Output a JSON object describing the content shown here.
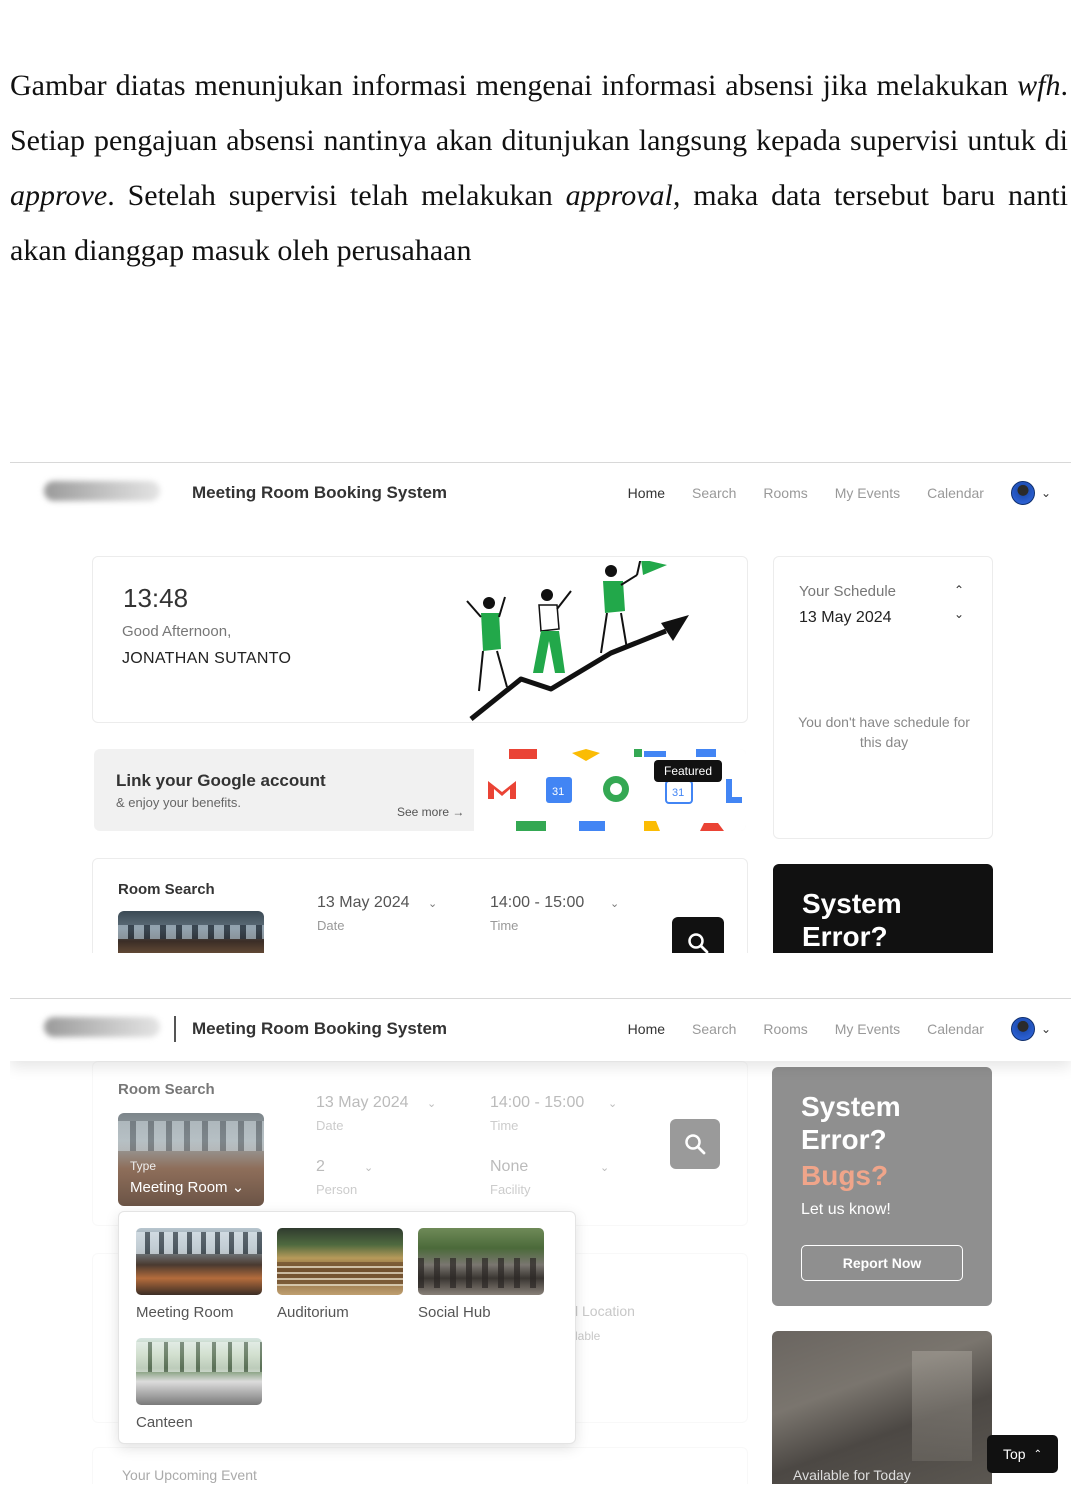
{
  "document": {
    "paragraph_parts": [
      "Gambar diatas menunjukan informasi mengenai informasi absensi jika melakukan ",
      "wfh",
      ". Setiap pengajuan absensi nantinya akan ditunjukan langsung kepada supervisi untuk di ",
      "approve",
      ". Setelah supervisi telah melakukan ",
      "approval,",
      " maka data tersebut baru nanti akan dianggap masuk oleh perusahaan"
    ]
  },
  "app": {
    "title": "Meeting Room Booking System",
    "nav": [
      "Home",
      "Search",
      "Rooms",
      "My Events",
      "Calendar"
    ],
    "active_nav": "Home",
    "caret": "⌄"
  },
  "dashboard": {
    "clock": "13:48",
    "greeting": "Good Afternoon,",
    "username": "JONATHAN SUTANTO",
    "schedule": {
      "title": "Your Schedule",
      "date": "13 May 2024",
      "up_icon": "⌃",
      "down_icon": "⌄",
      "empty": "You don't have schedule for this day"
    },
    "google": {
      "title": "Link your Google account",
      "subtitle": "& enjoy your benefits.",
      "see_more": "See more →",
      "featured": "Featured"
    },
    "room_search": {
      "title": "Room Search",
      "date_value": "13 May 2024",
      "date_label": "Date",
      "time_value": "14:00 - 15:00",
      "time_label": "Time"
    },
    "error": {
      "line1": "System",
      "line2": "Error?"
    }
  },
  "search_page": {
    "room_search": {
      "title": "Room Search",
      "type_label": "Type",
      "type_value": "Meeting Room ⌄",
      "date_value": "13 May 2024",
      "date_label": "Date",
      "time_value": "14:00 - 15:00",
      "time_label": "Time",
      "person_value": "2",
      "person_label": "Person",
      "facility_value": "None",
      "facility_label": "Facility"
    },
    "ghost": {
      "location": "l Location",
      "available": "lable"
    },
    "room_types": [
      "Meeting Room",
      "Auditorium",
      "Social Hub",
      "Canteen"
    ],
    "error": {
      "line1": "System",
      "line2": "Error?",
      "line3": "Bugs?",
      "sub": "Let us know!",
      "button": "Report Now"
    },
    "available": "Available for Today",
    "upcoming": "Your Upcoming Event",
    "top_button": "Top",
    "top_icon": "⌃"
  },
  "colors": {
    "accent_dark": "#111111",
    "illustration_green": "#22a84a",
    "bugs_orange": "#f0a58a"
  }
}
